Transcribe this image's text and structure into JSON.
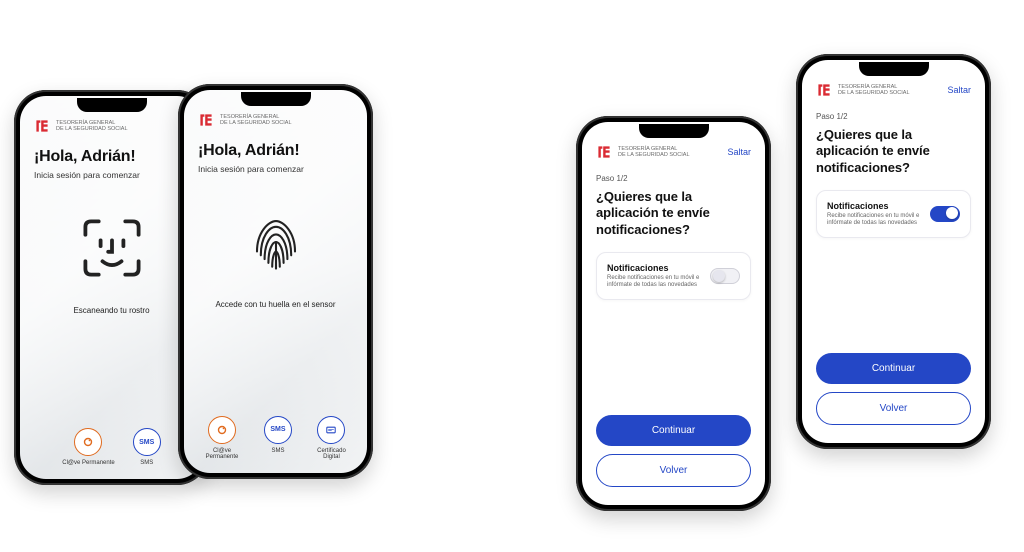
{
  "brand": {
    "line1": "TESORERÍA GENERAL",
    "line2": "DE LA SEGURIDAD SOCIAL"
  },
  "colors": {
    "accent_blue": "#2447c6",
    "accent_orange": "#e06a1e",
    "brand_red": "#da2b33"
  },
  "phone1": {
    "title": "¡Hola, Adrián!",
    "subtitle": "Inicia sesión para comenzar",
    "scan_caption": "Escaneando tu rostro",
    "methods": {
      "clave": "Cl@ve Permanente",
      "sms": "SMS"
    }
  },
  "phone2": {
    "title": "¡Hola, Adrián!",
    "subtitle": "Inicia sesión para comenzar",
    "scan_caption": "Accede con tu huella en el sensor",
    "methods": {
      "clave": "Cl@ve Permanente",
      "sms": "SMS",
      "cert": "Certificado Digital"
    }
  },
  "phone3": {
    "skip": "Saltar",
    "step": "Paso 1/2",
    "heading": "¿Quieres que la aplicación te envíe notificaciones?",
    "card_title": "Notificaciones",
    "card_desc": "Recibe notificaciones en tu móvil e infórmate de todas las novedades",
    "toggle_on": false,
    "continue": "Continuar",
    "back": "Volver"
  },
  "phone4": {
    "skip": "Saltar",
    "step": "Paso 1/2",
    "heading": "¿Quieres que la aplicación te envíe notificaciones?",
    "card_title": "Notificaciones",
    "card_desc": "Recibe notificaciones en tu móvil e infórmate de todas las novedades",
    "toggle_on": true,
    "continue": "Continuar",
    "back": "Volver"
  }
}
